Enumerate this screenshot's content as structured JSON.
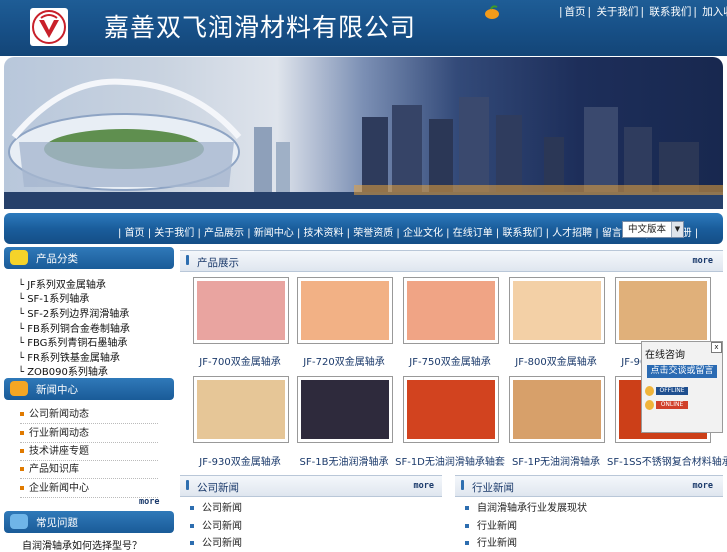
{
  "header": {
    "company_name": "嘉善双飞润滑材料有限公司",
    "top_nav": [
      "首页",
      "关于我们",
      "联系我们",
      "加入收藏夹"
    ]
  },
  "nav": {
    "items": [
      "首页",
      "关于我们",
      "产品展示",
      "新闻中心",
      "技术资料",
      "荣誉资质",
      "企业文化",
      "在线订单",
      "联系我们",
      "人才招聘",
      "留言反馈",
      "企业相册"
    ],
    "language_selected": "中文版本"
  },
  "sidebar": {
    "product_title": "产品分类",
    "products": [
      "JF系列双金属轴承",
      "SF-1系列轴承",
      "SF-2系列边界润滑轴承",
      "FB系列铜合金卷制轴承",
      "FBG系列青铜石墨轴承",
      "FR系列铁基金属轴承",
      "ZOB090系列轴承"
    ],
    "news_title": "新闻中心",
    "news": [
      "公司新闻动态",
      "行业新闻动态",
      "技术讲座专题",
      "产品知识库",
      "企业新闻中心"
    ],
    "more": "more",
    "faq_title": "常见问题",
    "faq": [
      "自润滑轴承如何选择型号？"
    ]
  },
  "products_section": {
    "title": "产品展示",
    "more": "more",
    "items": [
      {
        "caption": "JF-700双金属轴承",
        "color": "#e9a4a0"
      },
      {
        "caption": "JF-720双金属轴承",
        "color": "#f2b185"
      },
      {
        "caption": "JF-750双金属轴承",
        "color": "#f0a485"
      },
      {
        "caption": "JF-800双金属轴承",
        "color": "#f3d0a6"
      },
      {
        "caption": "JF-900双金属轴承",
        "color": "#e0b07a"
      },
      {
        "caption": "JF-930双金属轴承",
        "color": "#e6c697"
      },
      {
        "caption": "SF-1B无油润滑轴承",
        "color": "#2e2a3c"
      },
      {
        "caption": "SF-1D无油润滑轴承轴套",
        "color": "#d2431f"
      },
      {
        "caption": "SF-1P无油润滑轴承",
        "color": "#d7a06a"
      },
      {
        "caption": "SF-1SS不锈钢复合材料轴承",
        "color": "#cc3f18"
      }
    ]
  },
  "company_news": {
    "title": "公司新闻",
    "more": "more",
    "items": [
      "公司新闻",
      "公司新闻",
      "公司新闻"
    ]
  },
  "industry_news": {
    "title": "行业新闻",
    "more": "more",
    "items": [
      "自润滑轴承行业发展现状",
      "行业新闻",
      "行业新闻"
    ]
  },
  "chat": {
    "title": "在线咨询",
    "close": "x",
    "message_button": "点击交谈或留言",
    "offline": "OFFLINE",
    "online": "ONLINE"
  }
}
